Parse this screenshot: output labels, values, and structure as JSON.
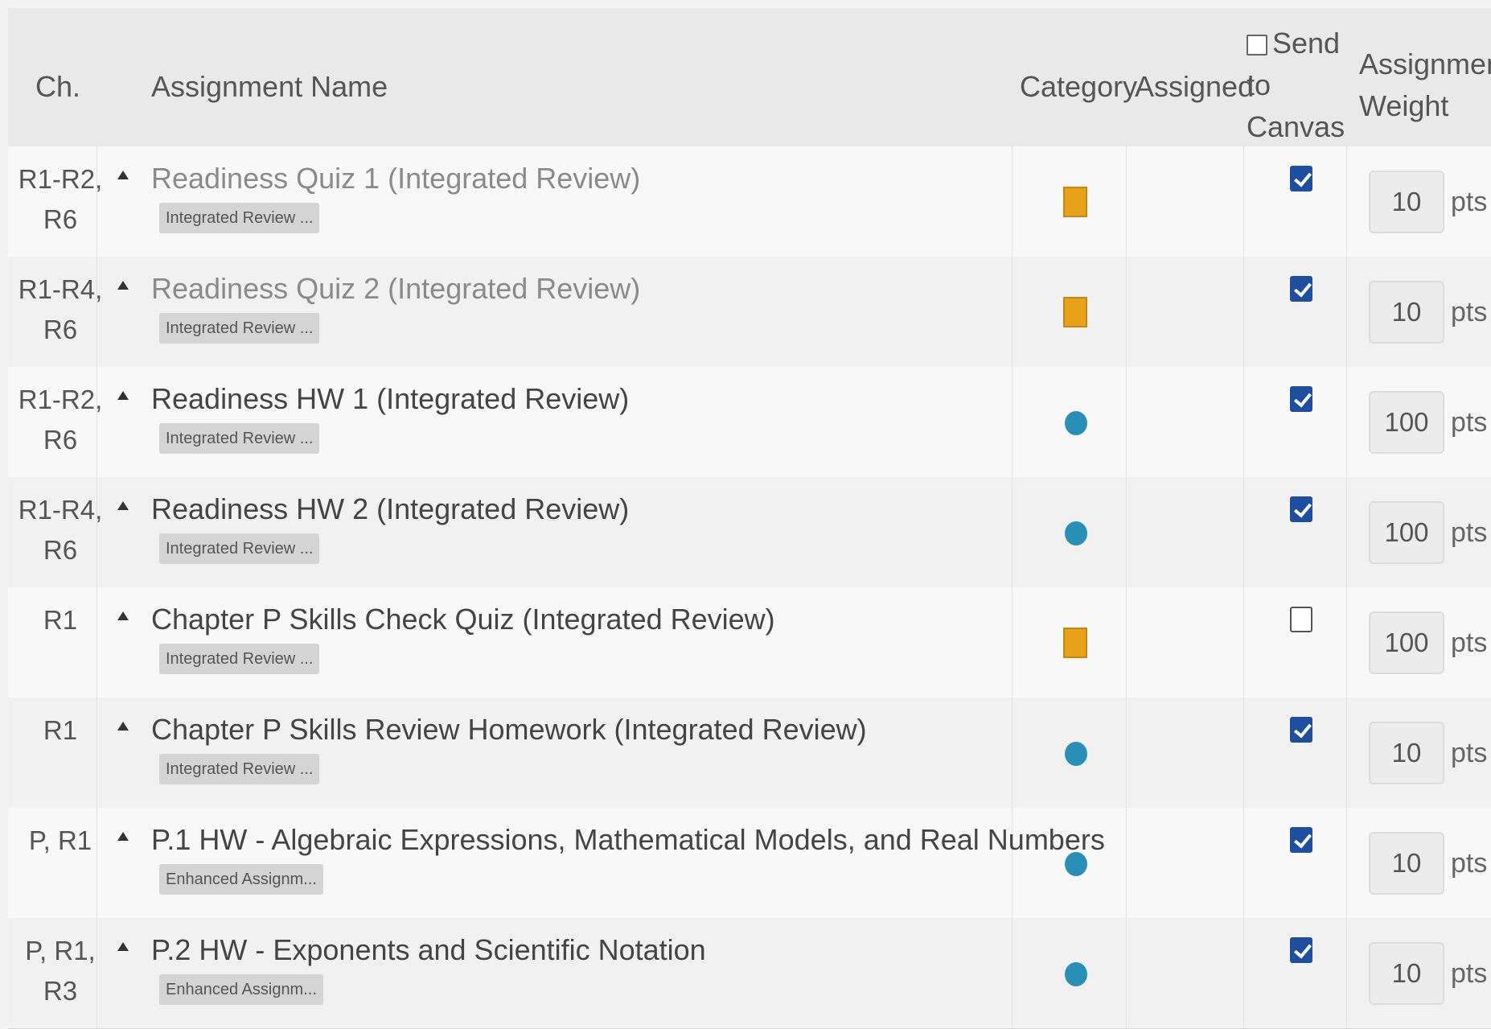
{
  "columns": {
    "ch": "Ch.",
    "name": "Assignment Name",
    "category": "Category",
    "assigned": "Assigned",
    "send_line1": "Send",
    "send_line2": "to",
    "send_line3": "Canvas",
    "weight_line1": "Assignment",
    "weight_line2": "Weight"
  },
  "rows": [
    {
      "ch1": "R1-R2,",
      "ch2": "R6",
      "name": "Readiness Quiz 1 (Integrated Review)",
      "tag": "Integrated Review ...",
      "category_icon": "quiz-square-orange",
      "send": true,
      "weight": "10",
      "unit": "pts"
    },
    {
      "ch1": "R1-R4,",
      "ch2": "R6",
      "name": "Readiness Quiz 2 (Integrated Review)",
      "tag": "Integrated Review ...",
      "category_icon": "quiz-square-orange",
      "send": true,
      "weight": "10",
      "unit": "pts"
    },
    {
      "ch1": "R1-R2,",
      "ch2": "R6",
      "name": "Readiness HW 1 (Integrated Review)",
      "tag": "Integrated Review ...",
      "category_icon": "homework-circle-blue",
      "send": true,
      "weight": "100",
      "unit": "pts"
    },
    {
      "ch1": "R1-R4,",
      "ch2": "R6",
      "name": "Readiness HW 2 (Integrated Review)",
      "tag": "Integrated Review ...",
      "category_icon": "homework-circle-blue",
      "send": true,
      "weight": "100",
      "unit": "pts"
    },
    {
      "ch1": "R1",
      "ch2": "",
      "name": "Chapter P Skills Check Quiz (Integrated Review)",
      "tag": "Integrated Review ...",
      "category_icon": "quiz-square-orange",
      "send": false,
      "weight": "100",
      "unit": "pts"
    },
    {
      "ch1": "R1",
      "ch2": "",
      "name": "Chapter P Skills Review Homework (Integrated Review)",
      "tag": "Integrated Review ...",
      "category_icon": "homework-circle-blue",
      "send": true,
      "weight": "10",
      "unit": "pts"
    },
    {
      "ch1": "P, R1",
      "ch2": "",
      "name": "P.1 HW - Algebraic Expressions, Mathematical Models, and Real Numbers",
      "tag": "Enhanced Assignm...",
      "category_icon": "homework-circle-blue",
      "send": true,
      "weight": "10",
      "unit": "pts"
    },
    {
      "ch1": "P, R1,",
      "ch2": "R3",
      "name": "P.2 HW - Exponents and Scientific Notation",
      "tag": "Enhanced Assignm...",
      "category_icon": "homework-circle-blue",
      "send": true,
      "weight": "10",
      "unit": "pts"
    }
  ],
  "colors": {
    "quiz": "#e8a21a",
    "homework": "#2a8fb6",
    "checkbox": "#1d4f9e"
  }
}
